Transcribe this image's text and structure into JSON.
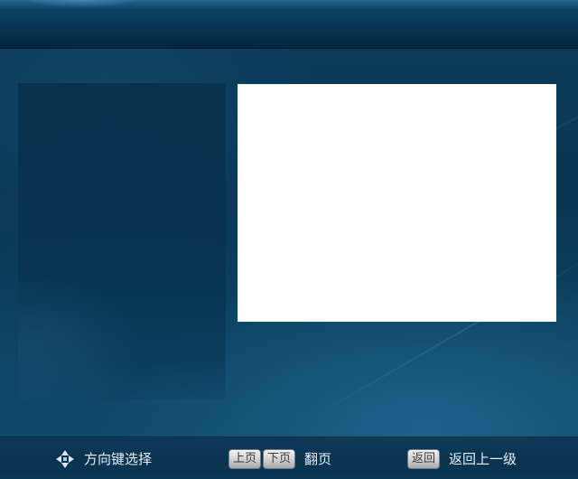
{
  "footer": {
    "navigate": {
      "icon": "dpad-arrows-icon",
      "label": "方向键选择"
    },
    "paging": {
      "prev_key": "上页",
      "next_key": "下页",
      "label": "翻页"
    },
    "back": {
      "key": "返回",
      "label": "返回上一级"
    }
  },
  "colors": {
    "background": "#0b3550",
    "preview": "#ffffff",
    "key_button": "#cfcfcf",
    "hint_text": "#e8eff5"
  }
}
